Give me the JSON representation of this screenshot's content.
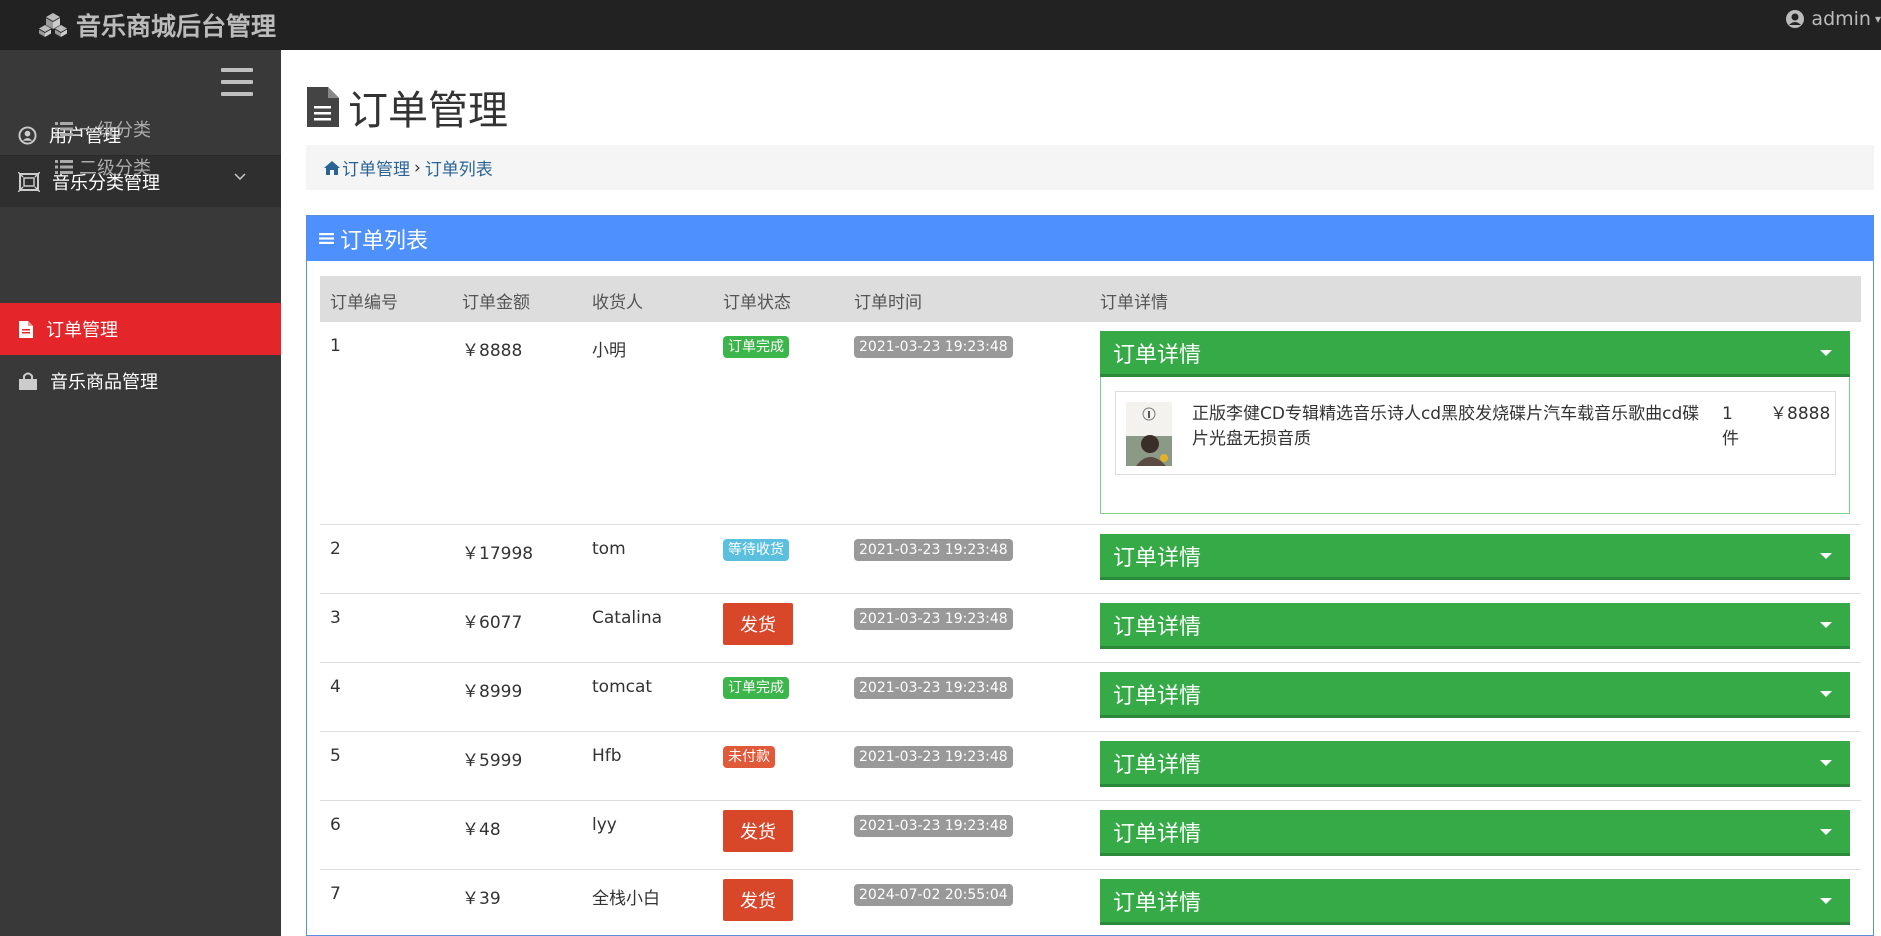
{
  "app": {
    "title": "音乐商城后台管理",
    "user": "admin"
  },
  "sidebar": {
    "items": [
      {
        "label": "用户管理",
        "icon": "user-circle-icon"
      },
      {
        "label": "音乐分类管理",
        "icon": "category-icon"
      },
      {
        "label": "订单管理",
        "icon": "file-icon",
        "active": true
      },
      {
        "label": "音乐商品管理",
        "icon": "shopping-bag-icon"
      }
    ],
    "submenu": [
      {
        "label": "一级分类",
        "icon": "list-icon"
      },
      {
        "label": "二级分类",
        "icon": "list-icon"
      }
    ]
  },
  "page": {
    "title": "订单管理"
  },
  "breadcrumb": {
    "home": "订单管理",
    "current": "订单列表"
  },
  "panel": {
    "title": "订单列表"
  },
  "table": {
    "headers": [
      "订单编号",
      "订单金额",
      "收货人",
      "订单状态",
      "订单时间",
      "订单详情"
    ],
    "detail_label": "订单详情",
    "ship_label": "发货",
    "rows": [
      {
        "id": "1",
        "amount": "￥8888",
        "receiver": "小明",
        "status": "订单完成",
        "status_type": "success",
        "time": "2021-03-23 19:23:48"
      },
      {
        "id": "2",
        "amount": "￥17998",
        "receiver": "tom",
        "status": "等待收货",
        "status_type": "info",
        "time": "2021-03-23 19:23:48"
      },
      {
        "id": "3",
        "amount": "￥6077",
        "receiver": "Catalina",
        "status": "发货",
        "status_type": "button",
        "time": "2021-03-23 19:23:48"
      },
      {
        "id": "4",
        "amount": "￥8999",
        "receiver": "tomcat",
        "status": "订单完成",
        "status_type": "success",
        "time": "2021-03-23 19:23:48"
      },
      {
        "id": "5",
        "amount": "￥5999",
        "receiver": "Hfb",
        "status": "未付款",
        "status_type": "danger",
        "time": "2021-03-23 19:23:48"
      },
      {
        "id": "6",
        "amount": "￥48",
        "receiver": "lyy",
        "status": "发货",
        "status_type": "button",
        "time": "2021-03-23 19:23:48"
      },
      {
        "id": "7",
        "amount": "￥39",
        "receiver": "全栈小白",
        "status": "发货",
        "status_type": "button",
        "time": "2024-07-02 20:55:04"
      }
    ],
    "expanded_detail": {
      "product_name": "正版李健CD专辑精选音乐诗人cd黑胶发烧碟片汽车载音乐歌曲cd碟片光盘无损音质",
      "quantity": "1件",
      "price": "￥8888"
    }
  },
  "colors": {
    "topbar": "#222222",
    "sidebar": "#393939",
    "active": "#e4262a",
    "panel": "#4d90fe",
    "detail": "#35aa47"
  }
}
